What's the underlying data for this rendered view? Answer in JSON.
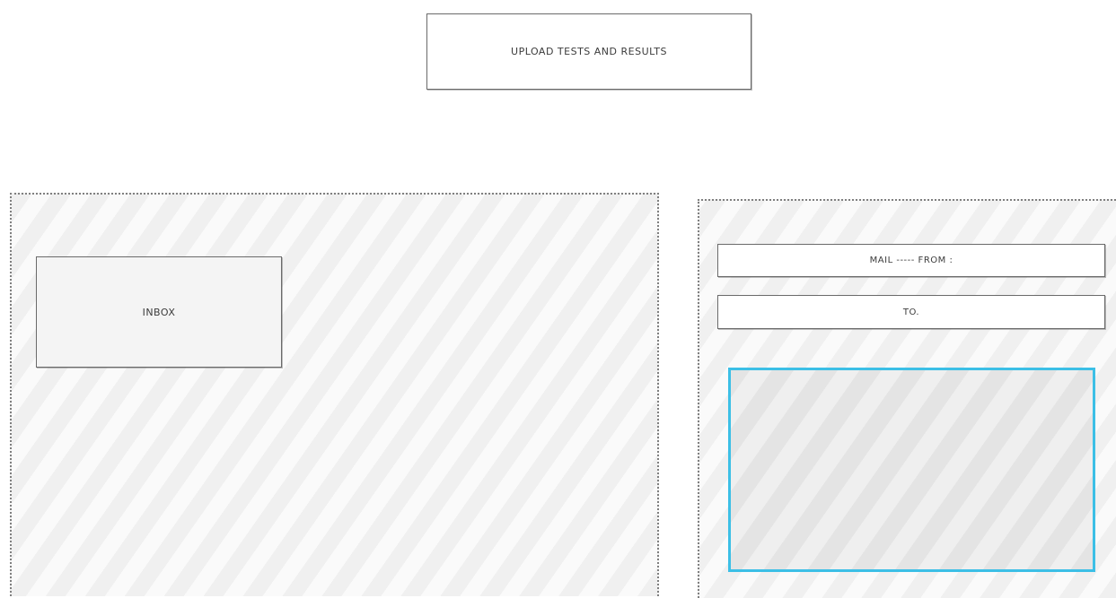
{
  "header": {
    "upload_label": "UPLOAD TESTS AND RESULTS"
  },
  "inbox_panel": {
    "inbox_label": "INBOX"
  },
  "mail_panel": {
    "from_label": "MAIL ----- FROM :",
    "to_label": "TO."
  },
  "colors": {
    "accent_border": "#3cbfe6"
  }
}
